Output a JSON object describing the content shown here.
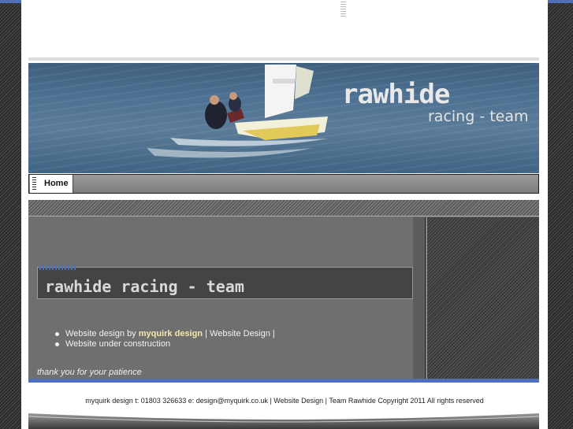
{
  "header": {
    "banner_title": "rawhide",
    "banner_subtitle": "racing - team"
  },
  "nav": {
    "items": [
      {
        "label": "Home"
      }
    ]
  },
  "main": {
    "heading": "rawhide racing - team",
    "bullets": {
      "item1_prefix": "Website design by ",
      "item1_link": "myquirk design",
      "item1_sep": " | ",
      "item1_link2": "Website Design",
      "item1_suffix": " |",
      "item2": "Website under construction"
    },
    "note": "thank you for your patience"
  },
  "footer": {
    "text": "myquirk design t: 01803 326633 e: design@myquirk.co.uk | Website Design | Team Rawhide Copyright 2011 All rights reserved"
  },
  "colors": {
    "accent_blue": "#4f6fb8",
    "link_highlight": "#f5e9a8"
  }
}
